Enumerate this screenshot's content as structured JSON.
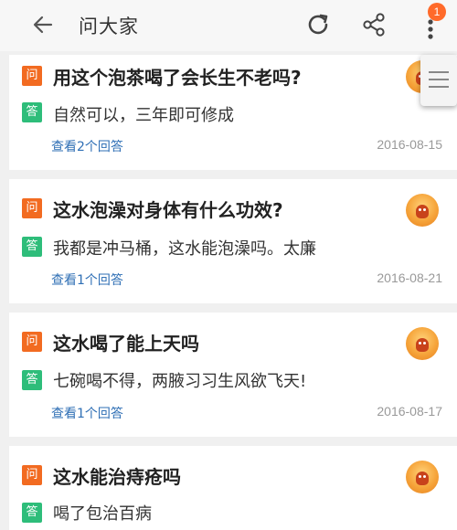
{
  "header": {
    "title": "问大家",
    "back_icon": "arrow-left-icon",
    "refresh_icon": "refresh-icon",
    "share_icon": "share-icon",
    "more_icon": "more-vertical-icon",
    "notification_count": "1"
  },
  "labels": {
    "question_tag": "问",
    "answer_tag": "答"
  },
  "questions": [
    {
      "question": "用这个泡茶喝了会长生不老吗?",
      "answer": "自然可以，三年即可修成",
      "answers_link": "查看2个回答",
      "date": "2016-08-15"
    },
    {
      "question": "这水泡澡对身体有什么功效?",
      "answer": "我都是冲马桶，这水能泡澡吗。太廉",
      "answers_link": "查看1个回答",
      "date": "2016-08-21"
    },
    {
      "question": "这水喝了能上天吗",
      "answer": "七碗喝不得，两腋习习生风欲飞天!",
      "answers_link": "查看1个回答",
      "date": "2016-08-17"
    },
    {
      "question": "这水能治痔疮吗",
      "answer": "喝了包治百病"
    }
  ],
  "colors": {
    "question_tag": "#f26b21",
    "answer_tag": "#2ebd7a",
    "link": "#2f6fb5",
    "badge": "#ff6a2a"
  }
}
